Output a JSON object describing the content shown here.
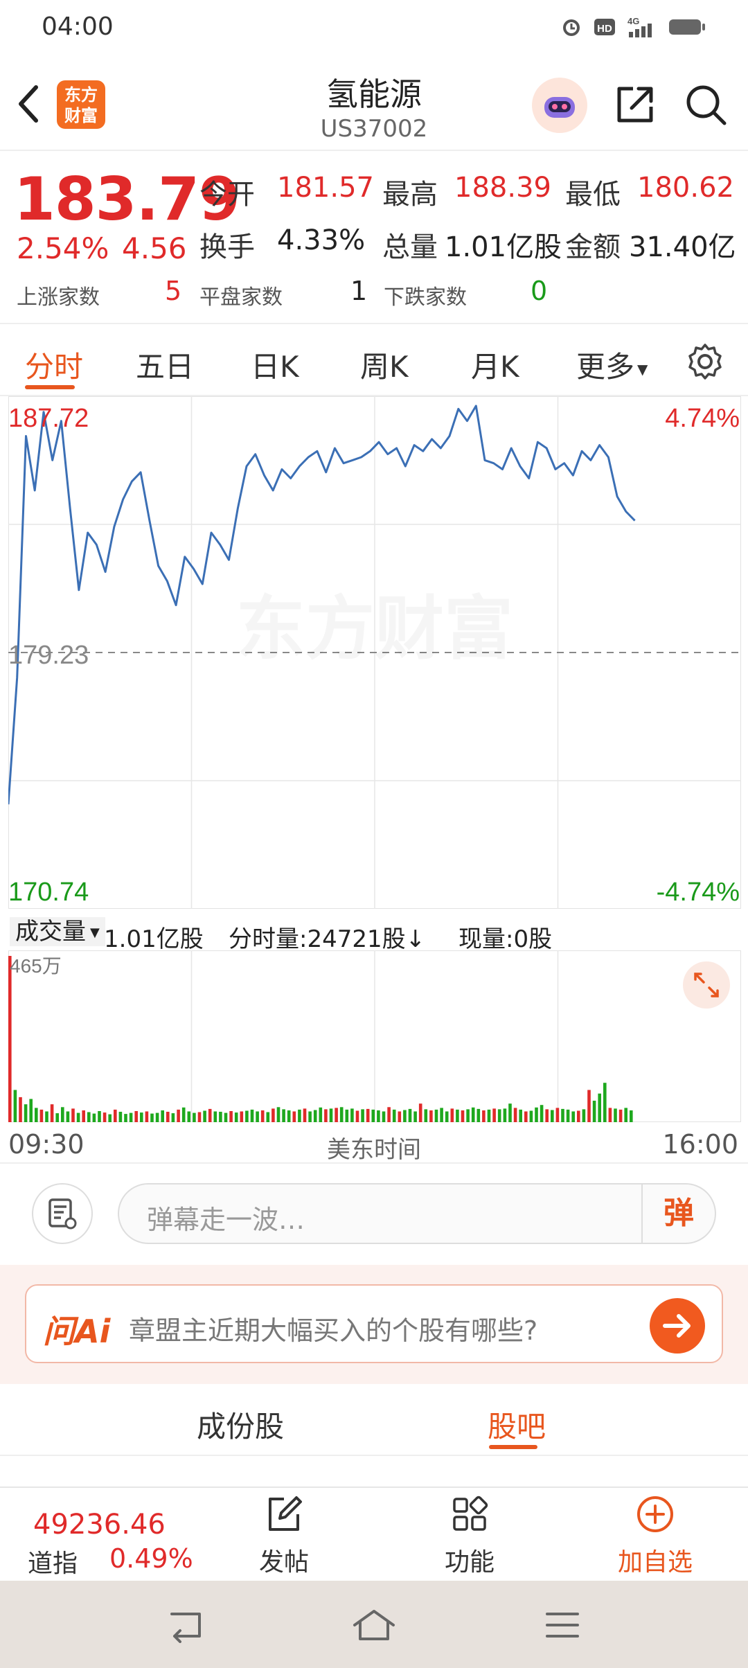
{
  "status_bar": {
    "time": "04:00",
    "icons": [
      "alarm-icon",
      "hd-icon",
      "4g-signal-icon",
      "battery-icon"
    ]
  },
  "header": {
    "back_icon": "chevron-left-icon",
    "logo_text_line1": "东方",
    "logo_text_line2": "财富",
    "title": "氢能源",
    "code": "US37002",
    "share_icon": "share-icon",
    "search_icon": "search-icon"
  },
  "quote": {
    "price": "183.79",
    "change_pct": "2.54%",
    "change": "4.56",
    "open_label": "今开",
    "open": "181.57",
    "high_label": "最高",
    "high": "188.39",
    "low_label": "最低",
    "low": "180.62",
    "turnover_label": "换手",
    "turnover": "4.33%",
    "volume_label": "总量",
    "volume": "1.01亿股",
    "amount_label": "金额",
    "amount": "31.40亿",
    "up_label": "上涨家数",
    "up": "5",
    "flat_label": "平盘家数",
    "flat": "1",
    "down_label": "下跌家数",
    "down": "0"
  },
  "tabs": [
    "分时",
    "五日",
    "日K",
    "周K",
    "月K",
    "更多"
  ],
  "chart_data": {
    "type": "line",
    "title": "",
    "y_top_label": "187.72",
    "y_mid_label": "179.23",
    "y_bottom_label": "170.74",
    "pct_top_label": "4.74%",
    "pct_bottom_label": "-4.74%",
    "watermark": "东方财富",
    "ylim": [
      170.74,
      187.72
    ],
    "prev_close": 179.23,
    "values": [
      174.2,
      178.4,
      186.4,
      184.6,
      187.2,
      185.6,
      186.9,
      184.0,
      181.3,
      183.2,
      182.8,
      181.9,
      183.4,
      184.3,
      184.9,
      185.2,
      183.6,
      182.1,
      181.6,
      180.8,
      182.4,
      182.0,
      181.5,
      183.2,
      182.8,
      182.3,
      184.0,
      185.4,
      185.8,
      185.1,
      184.6,
      185.3,
      185.0,
      185.4,
      185.7,
      185.9,
      185.2,
      186.0,
      185.5,
      185.6,
      185.7,
      185.9,
      186.2,
      185.8,
      186.0,
      185.4,
      186.1,
      185.9,
      186.3,
      186.0,
      186.4,
      187.3,
      186.9,
      187.4,
      185.6,
      185.5,
      185.3,
      186.0,
      185.4,
      185.0,
      186.2,
      186.0,
      185.3,
      185.5,
      185.1,
      185.9,
      185.6,
      186.1,
      185.7,
      184.4,
      183.9,
      183.6
    ]
  },
  "volume_panel": {
    "selector": "成交量",
    "total": "1.01亿股",
    "minute_volume": "分时量:24721股↓",
    "current": "现量:0股",
    "max_label": "465万",
    "expand_icon": "expand-icon"
  },
  "volume_data": {
    "type": "bar",
    "max": 4650000,
    "values": [
      4650000,
      900000,
      700000,
      500000,
      650000,
      400000,
      350000,
      300000,
      500000,
      250000,
      420000,
      300000,
      380000,
      260000,
      330000,
      280000,
      240000,
      310000,
      270000,
      220000,
      350000,
      290000,
      230000,
      260000,
      310000,
      270000,
      300000,
      240000,
      260000,
      330000,
      290000,
      250000,
      350000,
      410000,
      300000,
      260000,
      280000,
      320000,
      370000,
      300000,
      290000,
      260000,
      310000,
      270000,
      300000,
      320000,
      350000,
      300000,
      330000,
      280000,
      380000,
      420000,
      360000,
      330000,
      300000,
      350000,
      380000,
      300000,
      340000,
      410000,
      360000,
      380000,
      400000,
      420000,
      350000,
      380000,
      320000,
      360000,
      370000,
      350000,
      330000,
      300000,
      420000,
      350000,
      300000,
      340000,
      370000,
      300000,
      520000,
      360000,
      330000,
      350000,
      400000,
      300000,
      380000,
      350000,
      330000,
      360000,
      410000,
      370000,
      330000,
      350000,
      380000,
      360000,
      380000,
      520000,
      400000,
      350000,
      300000,
      320000,
      410000,
      480000,
      360000,
      340000,
      400000,
      370000,
      350000,
      300000,
      320000,
      360000,
      900000,
      600000,
      800000,
      1100000,
      400000,
      380000,
      350000,
      400000,
      330000
    ]
  },
  "axis": {
    "start": "09:30",
    "center": "美东时间",
    "end": "16:00"
  },
  "danmu": {
    "placeholder": "弹幕走一波…",
    "button": "弹"
  },
  "ai": {
    "logo": "问Ai",
    "prompt": "章盟主近期大幅买入的个股有哪些?"
  },
  "sub_tabs": [
    "成份股",
    "股吧"
  ],
  "bottom_nav": {
    "index_value": "49236.46",
    "index_name": "道指",
    "index_pct": "0.49%",
    "post": "发帖",
    "function": "功能",
    "add_watch": "加自选"
  }
}
